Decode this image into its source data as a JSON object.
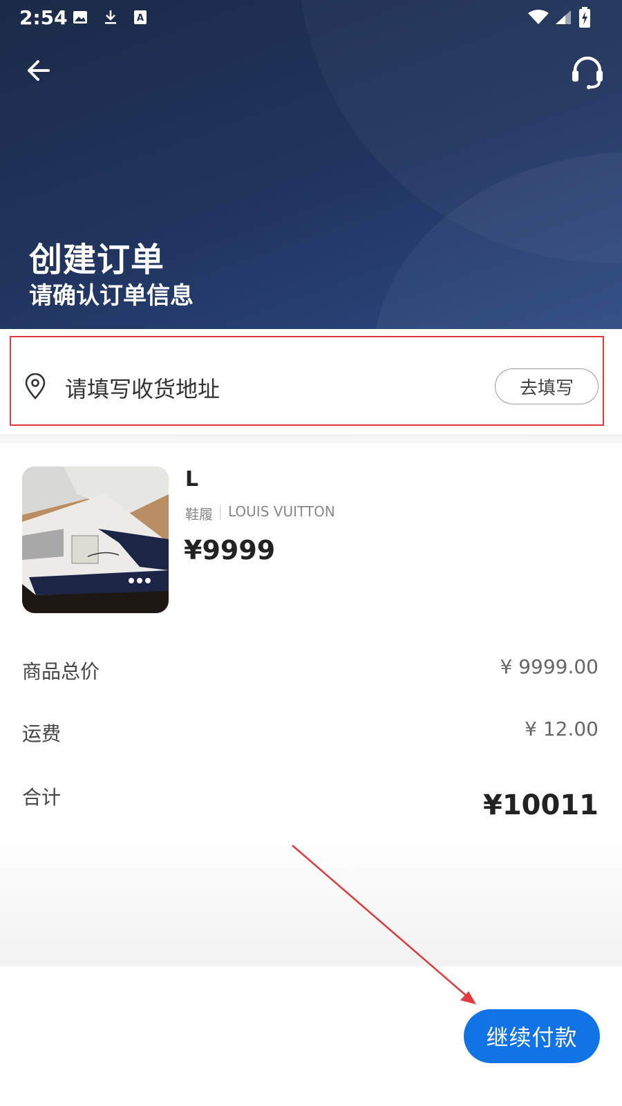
{
  "status_bar": {
    "time": "2:54",
    "notification_icons": [
      "image-icon",
      "download-icon",
      "text-a-icon"
    ],
    "system_icons": [
      "wifi-icon",
      "signal-icon",
      "battery-icon"
    ]
  },
  "header": {
    "title": "创建订单",
    "subtitle": "请确认订单信息",
    "back_icon": "arrow-left-icon",
    "support_icon": "headset-icon"
  },
  "address": {
    "placeholder": "请填写收货地址",
    "button_label": "去填写",
    "icon": "location-pin-icon"
  },
  "product": {
    "name": "L",
    "category": "鞋履",
    "brand": "LOUIS VUITTON",
    "price": "¥9999"
  },
  "summary": {
    "subtotal_label": "商品总价",
    "subtotal_value": "¥ 9999.00",
    "shipping_label": "运费",
    "shipping_value": "¥ 12.00",
    "total_label": "合计",
    "total_value": "¥10011"
  },
  "footer": {
    "pay_button_label": "继续付款"
  },
  "colors": {
    "header_bg": "#213560",
    "accent_blue": "#1273e6",
    "annotation_red": "#e0393e"
  }
}
